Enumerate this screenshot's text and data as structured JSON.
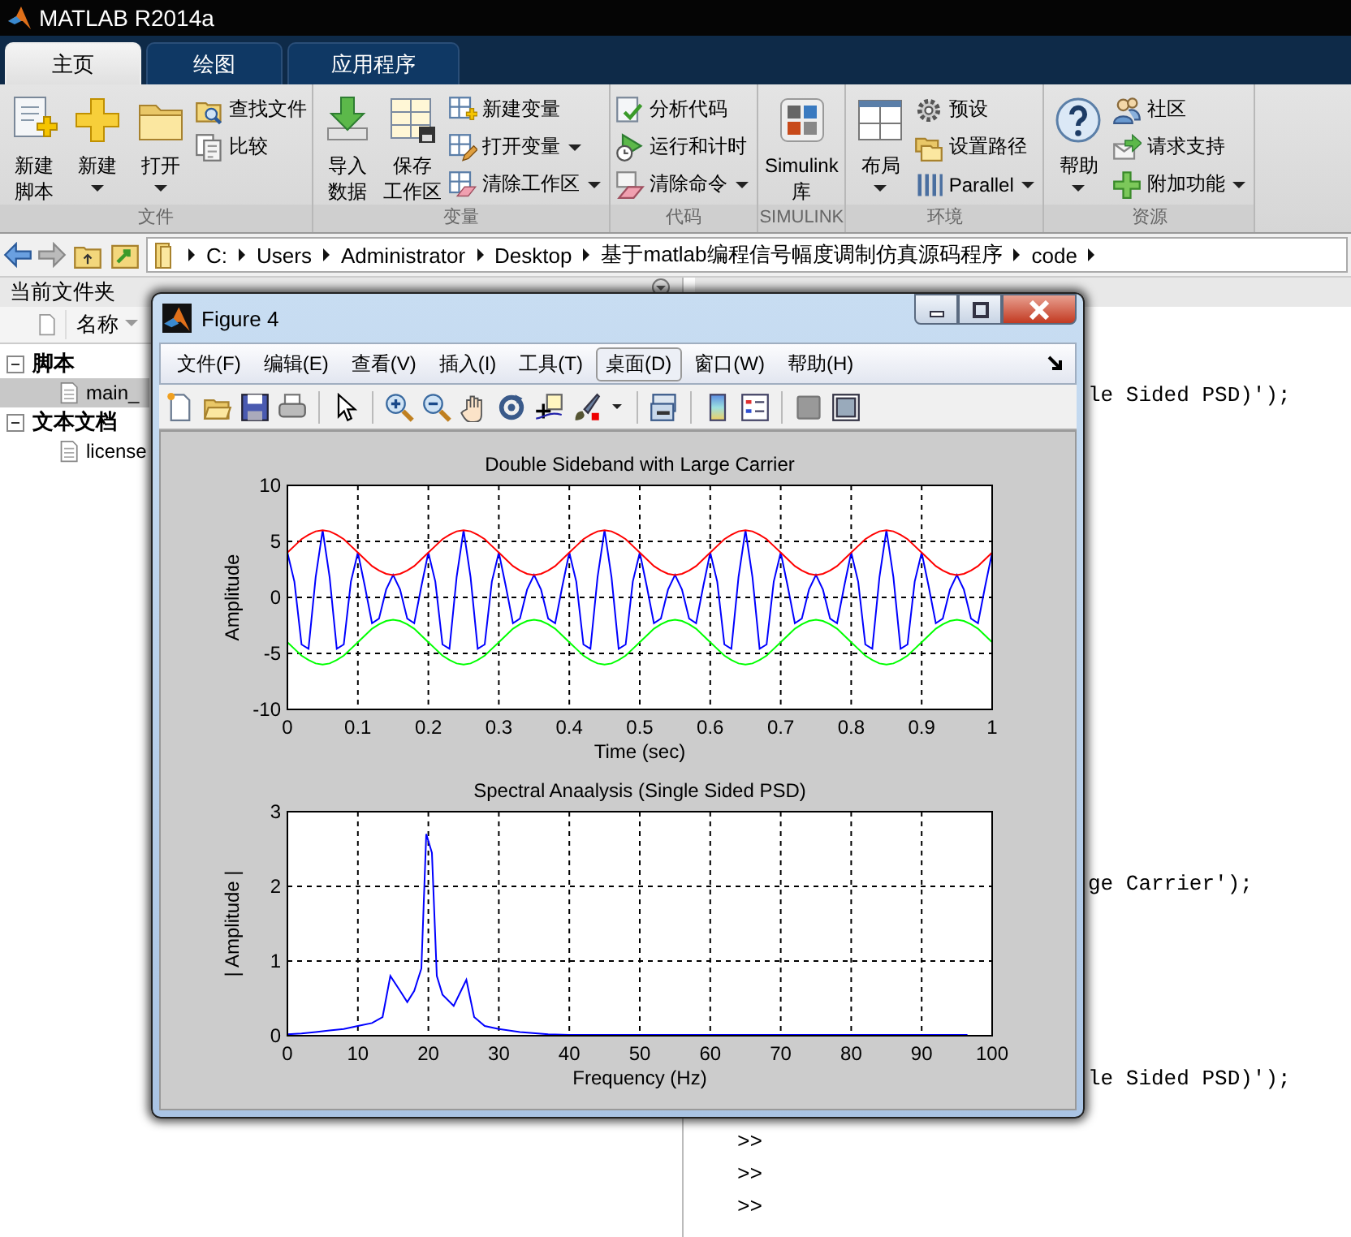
{
  "app": {
    "title": "MATLAB R2014a"
  },
  "tabs": [
    {
      "label": "主页",
      "selected": true
    },
    {
      "label": "绘图",
      "selected": false
    },
    {
      "label": "应用程序",
      "selected": false
    }
  ],
  "toolstrip": [
    {
      "label": "文件",
      "items": [
        {
          "kind": "large",
          "lines": [
            "新建",
            "脚本"
          ],
          "dropdown": false
        },
        {
          "kind": "large",
          "lines": [
            "新建"
          ],
          "dropdown": true
        },
        {
          "kind": "large",
          "lines": [
            "打开"
          ],
          "dropdown": true
        },
        {
          "kind": "stack",
          "items": [
            {
              "label": "查找文件",
              "dropdown": false
            },
            {
              "label": "比较",
              "dropdown": false
            }
          ]
        }
      ]
    },
    {
      "label": "变量",
      "items": [
        {
          "kind": "large",
          "lines": [
            "导入",
            "数据"
          ],
          "dropdown": false
        },
        {
          "kind": "large",
          "lines": [
            "保存",
            "工作区"
          ],
          "dropdown": false
        },
        {
          "kind": "stack",
          "items": [
            {
              "label": "新建变量",
              "dropdown": false
            },
            {
              "label": "打开变量",
              "dropdown": true
            },
            {
              "label": "清除工作区",
              "dropdown": true
            }
          ]
        }
      ]
    },
    {
      "label": "代码",
      "items": [
        {
          "kind": "stack",
          "items": [
            {
              "label": "分析代码",
              "dropdown": false
            },
            {
              "label": "运行和计时",
              "dropdown": false
            },
            {
              "label": "清除命令",
              "dropdown": true
            }
          ]
        }
      ]
    },
    {
      "label": "SIMULINK",
      "items": [
        {
          "kind": "large",
          "lines": [
            "Simulink",
            "库"
          ],
          "dropdown": false
        }
      ]
    },
    {
      "label": "环境",
      "items": [
        {
          "kind": "large",
          "lines": [
            "布局"
          ],
          "dropdown": true
        },
        {
          "kind": "stack",
          "items": [
            {
              "label": "预设",
              "dropdown": false
            },
            {
              "label": "设置路径",
              "dropdown": false
            },
            {
              "label": "Parallel",
              "dropdown": true
            }
          ]
        }
      ]
    },
    {
      "label": "资源",
      "items": [
        {
          "kind": "large",
          "lines": [
            "帮助"
          ],
          "dropdown": true
        },
        {
          "kind": "stack",
          "items": [
            {
              "label": "社区",
              "dropdown": false
            },
            {
              "label": "请求支持",
              "dropdown": false
            },
            {
              "label": "附加功能",
              "dropdown": true
            }
          ]
        }
      ]
    }
  ],
  "address": {
    "path": [
      "C:",
      "Users",
      "Administrator",
      "Desktop",
      "基于matlab编程信号幅度调制仿真源码程序",
      "code"
    ]
  },
  "current_folder": {
    "title": "当前文件夹",
    "column": "名称",
    "groups": [
      {
        "label": "脚本",
        "expanded": true,
        "children": [
          {
            "name": "main_",
            "selected": true
          }
        ]
      },
      {
        "label": "文本文档",
        "expanded": true,
        "children": [
          {
            "name": "license",
            "selected": false
          }
        ]
      }
    ]
  },
  "command_window": {
    "lines": [
      {
        "kind": "code",
        "text": "le Sided PSD)');"
      },
      {
        "kind": "code",
        "text": "ge Carrier');"
      },
      {
        "kind": "code",
        "text": "le Sided PSD)');"
      },
      {
        "kind": "prompt",
        "text": ">>"
      },
      {
        "kind": "prompt",
        "text": ">>"
      },
      {
        "kind": "prompt",
        "text": ">>"
      }
    ]
  },
  "figure": {
    "title": "Figure 4",
    "menus": [
      {
        "label": "文件(F)",
        "hovered": false
      },
      {
        "label": "编辑(E)",
        "hovered": false
      },
      {
        "label": "查看(V)",
        "hovered": false
      },
      {
        "label": "插入(I)",
        "hovered": false
      },
      {
        "label": "工具(T)",
        "hovered": false
      },
      {
        "label": "桌面(D)",
        "hovered": true
      },
      {
        "label": "窗口(W)",
        "hovered": false
      },
      {
        "label": "帮助(H)",
        "hovered": false
      }
    ],
    "charts": [
      {
        "chart_data": {
          "type": "line",
          "title": "Double Sideband with Large Carrier",
          "xlabel": "Time (sec)",
          "ylabel": "Amplitude",
          "xlim": [
            0,
            1
          ],
          "ylim": [
            -10,
            10
          ],
          "xticks": [
            0,
            0.1,
            0.2,
            0.3,
            0.4,
            0.5,
            0.6,
            0.7,
            0.8,
            0.9,
            1
          ],
          "yticks": [
            -10,
            -5,
            0,
            5,
            10
          ],
          "grid": true,
          "x": [
            0,
            0.01,
            0.02,
            0.03,
            0.04,
            0.05,
            0.06,
            0.07,
            0.08,
            0.09,
            0.1,
            0.11,
            0.12,
            0.13,
            0.14,
            0.15,
            0.16,
            0.17,
            0.18,
            0.19,
            0.2,
            0.21,
            0.22,
            0.23,
            0.24,
            0.25,
            0.26,
            0.27,
            0.28,
            0.29,
            0.3,
            0.31,
            0.32,
            0.33,
            0.34,
            0.35,
            0.36,
            0.37,
            0.38,
            0.39,
            0.4,
            0.41,
            0.42,
            0.43,
            0.44,
            0.45,
            0.46,
            0.47,
            0.48,
            0.49,
            0.5,
            0.51,
            0.52,
            0.53,
            0.54,
            0.55,
            0.56,
            0.57,
            0.58,
            0.59,
            0.6,
            0.61,
            0.62,
            0.63,
            0.64,
            0.65,
            0.66,
            0.67,
            0.68,
            0.69,
            0.7,
            0.71,
            0.72,
            0.73,
            0.74,
            0.75,
            0.76,
            0.77,
            0.78,
            0.79,
            0.8,
            0.81,
            0.82,
            0.83,
            0.84,
            0.85,
            0.86,
            0.87,
            0.88,
            0.89,
            0.9,
            0.91,
            0.92,
            0.93,
            0.94,
            0.95,
            0.96,
            0.97,
            0.98,
            0.99,
            1
          ],
          "series": [
            {
              "color": "#0000ff",
              "values": [
                4,
                1.4,
                -4.2,
                -4.6,
                1.8,
                6,
                1.8,
                -4.6,
                -4.2,
                1.4,
                4,
                1,
                -2.3,
                -1.9,
                0.7,
                2,
                0.7,
                -1.9,
                -2.3,
                1,
                4,
                1.4,
                -4.2,
                -4.6,
                1.8,
                6,
                1.8,
                -4.6,
                -4.2,
                1.4,
                4,
                1,
                -2.3,
                -1.9,
                0.7,
                2,
                0.7,
                -1.9,
                -2.3,
                1,
                4,
                1.4,
                -4.2,
                -4.6,
                1.8,
                6,
                1.8,
                -4.6,
                -4.2,
                1.4,
                4,
                1,
                -2.3,
                -1.9,
                0.7,
                2,
                0.7,
                -1.9,
                -2.3,
                1,
                4,
                1.4,
                -4.2,
                -4.6,
                1.8,
                6,
                1.8,
                -4.6,
                -4.2,
                1.4,
                4,
                1,
                -2.3,
                -1.9,
                0.7,
                2,
                0.7,
                -1.9,
                -2.3,
                1,
                4,
                1.4,
                -4.2,
                -4.6,
                1.8,
                6,
                1.8,
                -4.6,
                -4.2,
                1.4,
                4,
                1,
                -2.3,
                -1.9,
                0.7,
                2,
                0.7,
                -1.9,
                -2.3,
                1,
                4
              ]
            },
            {
              "color": "#ff0000",
              "values": [
                4,
                4.6,
                5.2,
                5.6,
                5.9,
                6,
                5.9,
                5.6,
                5.2,
                4.6,
                4,
                3.4,
                2.8,
                2.4,
                2.1,
                2,
                2.1,
                2.4,
                2.8,
                3.4,
                4,
                4.6,
                5.2,
                5.6,
                5.9,
                6,
                5.9,
                5.6,
                5.2,
                4.6,
                4,
                3.4,
                2.8,
                2.4,
                2.1,
                2,
                2.1,
                2.4,
                2.8,
                3.4,
                4,
                4.6,
                5.2,
                5.6,
                5.9,
                6,
                5.9,
                5.6,
                5.2,
                4.6,
                4,
                3.4,
                2.8,
                2.4,
                2.1,
                2,
                2.1,
                2.4,
                2.8,
                3.4,
                4,
                4.6,
                5.2,
                5.6,
                5.9,
                6,
                5.9,
                5.6,
                5.2,
                4.6,
                4,
                3.4,
                2.8,
                2.4,
                2.1,
                2,
                2.1,
                2.4,
                2.8,
                3.4,
                4,
                4.6,
                5.2,
                5.6,
                5.9,
                6,
                5.9,
                5.6,
                5.2,
                4.6,
                4,
                3.4,
                2.8,
                2.4,
                2.1,
                2,
                2.1,
                2.4,
                2.8,
                3.4,
                4
              ]
            },
            {
              "color": "#00ff00",
              "values": [
                -4,
                -4.6,
                -5.2,
                -5.6,
                -5.9,
                -6,
                -5.9,
                -5.6,
                -5.2,
                -4.6,
                -4,
                -3.4,
                -2.8,
                -2.4,
                -2.1,
                -2,
                -2.1,
                -2.4,
                -2.8,
                -3.4,
                -4,
                -4.6,
                -5.2,
                -5.6,
                -5.9,
                -6,
                -5.9,
                -5.6,
                -5.2,
                -4.6,
                -4,
                -3.4,
                -2.8,
                -2.4,
                -2.1,
                -2,
                -2.1,
                -2.4,
                -2.8,
                -3.4,
                -4,
                -4.6,
                -5.2,
                -5.6,
                -5.9,
                -6,
                -5.9,
                -5.6,
                -5.2,
                -4.6,
                -4,
                -3.4,
                -2.8,
                -2.4,
                -2.1,
                -2,
                -2.1,
                -2.4,
                -2.8,
                -3.4,
                -4,
                -4.6,
                -5.2,
                -5.6,
                -5.9,
                -6,
                -5.9,
                -5.6,
                -5.2,
                -4.6,
                -4,
                -3.4,
                -2.8,
                -2.4,
                -2.1,
                -2,
                -2.1,
                -2.4,
                -2.8,
                -3.4,
                -4,
                -4.6,
                -5.2,
                -5.6,
                -5.9,
                -6,
                -5.9,
                -5.6,
                -5.2,
                -4.6,
                -4,
                -3.4,
                -2.8,
                -2.4,
                -2.1,
                -2,
                -2.1,
                -2.4,
                -2.8,
                -3.4,
                -4
              ]
            }
          ]
        }
      },
      {
        "chart_data": {
          "type": "line",
          "title": "Spectral Anaalysis (Single Sided PSD)",
          "xlabel": "Frequency (Hz)",
          "ylabel": "| Amplitude |",
          "xlim": [
            0,
            100
          ],
          "ylim": [
            0,
            3
          ],
          "xticks": [
            0,
            10,
            20,
            30,
            40,
            50,
            60,
            70,
            80,
            90,
            100
          ],
          "yticks": [
            0,
            1,
            2,
            3
          ],
          "grid": true,
          "x": [
            0,
            2,
            4,
            6,
            8,
            10,
            12,
            13.5,
            14.6,
            16,
            17,
            18,
            19,
            19.7,
            20.5,
            21.2,
            22,
            23.6,
            25.4,
            26.5,
            28,
            30,
            33,
            37,
            40,
            50,
            60,
            70,
            80,
            90,
            96.5
          ],
          "series": [
            {
              "color": "#0000ff",
              "values": [
                0.02,
                0.03,
                0.05,
                0.07,
                0.09,
                0.13,
                0.17,
                0.25,
                0.8,
                0.6,
                0.45,
                0.6,
                0.9,
                2.7,
                2.45,
                0.8,
                0.55,
                0.4,
                0.75,
                0.25,
                0.13,
                0.09,
                0.05,
                0.02,
                0.01,
                0.01,
                0.01,
                0.01,
                0.01,
                0.01,
                0.01
              ]
            }
          ]
        }
      }
    ]
  }
}
